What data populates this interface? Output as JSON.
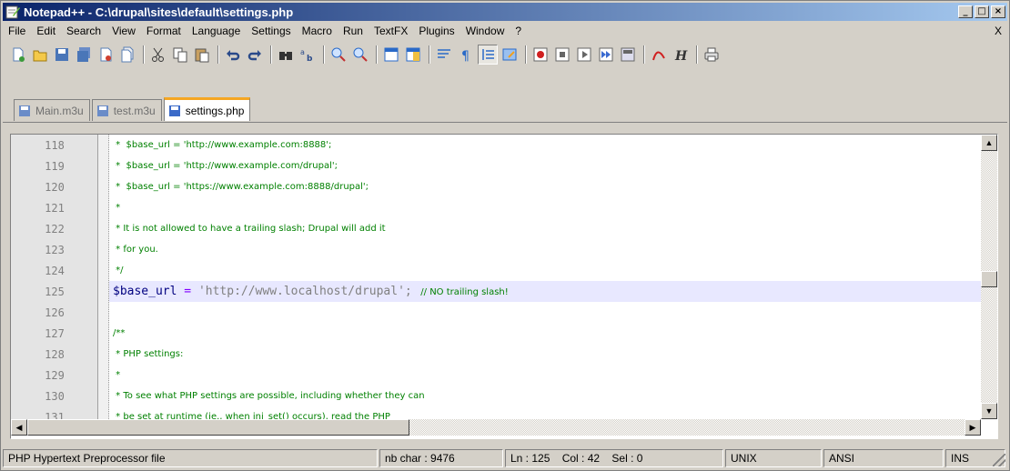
{
  "window": {
    "title": "Notepad++ - C:\\drupal\\sites\\default\\settings.php",
    "minimize": "_",
    "maximize": "□",
    "close": "×"
  },
  "menu": {
    "items": [
      "File",
      "Edit",
      "Search",
      "View",
      "Format",
      "Language",
      "Settings",
      "Macro",
      "Run",
      "TextFX",
      "Plugins",
      "Window",
      "?"
    ],
    "close": "X"
  },
  "tabs": [
    {
      "label": "Main.m3u",
      "active": false
    },
    {
      "label": "test.m3u",
      "active": false
    },
    {
      "label": "settings.php",
      "active": true
    }
  ],
  "editor": {
    "current_line": 125,
    "lines": [
      {
        "num": "118",
        "text": " *  $base_url = 'http://www.example.com:8888';"
      },
      {
        "num": "119",
        "text": " *  $base_url = 'http://www.example.com/drupal';"
      },
      {
        "num": "120",
        "text": " *  $base_url = 'https://www.example.com:8888/drupal';"
      },
      {
        "num": "121",
        "text": " *"
      },
      {
        "num": "122",
        "text": " * It is not allowed to have a trailing slash; Drupal will add it"
      },
      {
        "num": "123",
        "text": " * for you."
      },
      {
        "num": "124",
        "text": " */"
      },
      {
        "num": "125",
        "var": "$base_url",
        "op": " = ",
        "str": "'http://www.localhost/drupal';",
        "comment": "   // NO trailing slash!"
      },
      {
        "num": "126",
        "text": ""
      },
      {
        "num": "127",
        "text": "/**"
      },
      {
        "num": "128",
        "text": " * PHP settings:"
      },
      {
        "num": "129",
        "text": " *"
      },
      {
        "num": "130",
        "text": " * To see what PHP settings are possible, including whether they can"
      },
      {
        "num": "131",
        "text": " * be set at runtime (ie., when ini_set() occurs), read the PHP"
      }
    ]
  },
  "status": {
    "filetype": "PHP Hypertext Preprocessor file",
    "chars": "nb char : 9476",
    "position": "Ln : 125    Col : 42    Sel : 0",
    "eol": "UNIX",
    "encoding": "ANSI",
    "mode": "INS"
  }
}
